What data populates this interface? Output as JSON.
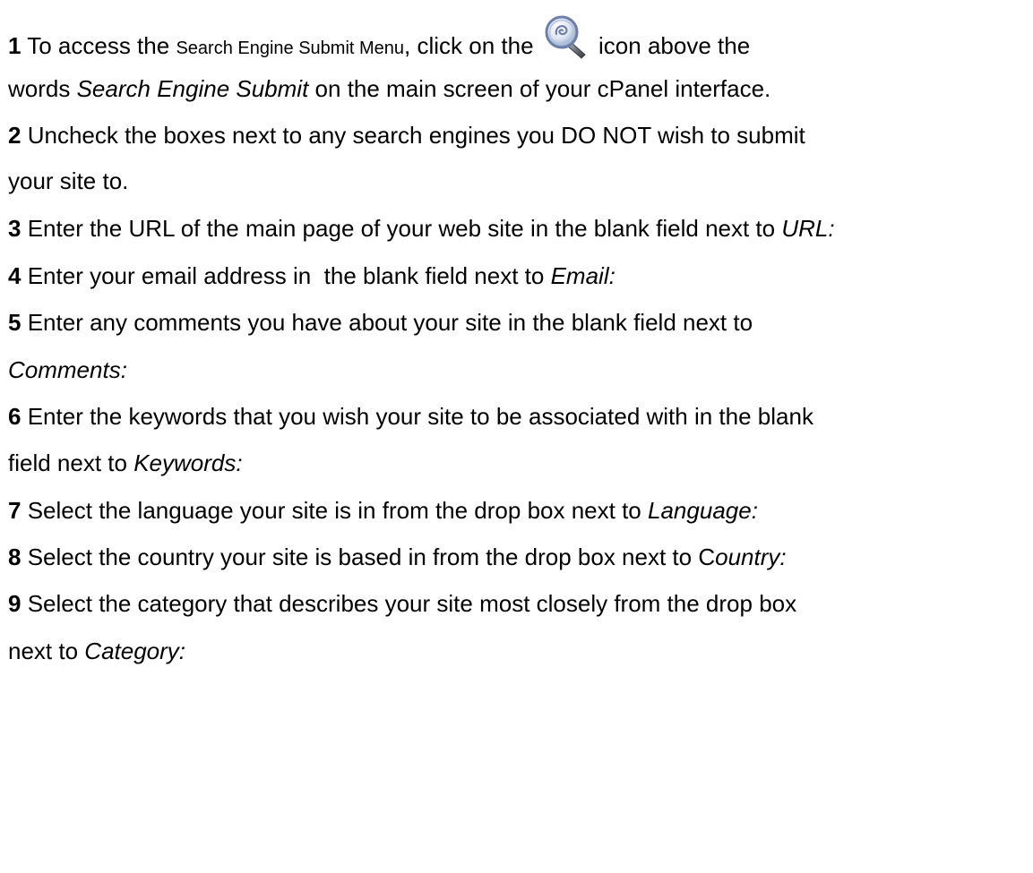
{
  "steps": [
    {
      "number": "1",
      "l1_a": "To access the",
      "l1_b": "Search Engine Submit Menu",
      "l1_c": ", click on the",
      "icon": "search-magnifier-icon",
      "l1_d": "icon above the",
      "l2_a": "words",
      "l2_b": "Search Engine Submit",
      "l2_c": "on the main screen of your cPanel interface."
    },
    {
      "number": "2",
      "l1": "Uncheck the boxes next to any search engines you DO NOT wish to submit",
      "l2": "your site to."
    },
    {
      "number": "3",
      "l1_a": "Enter the URL of the main page of your web site in the blank field next to",
      "l1_b": "URL:"
    },
    {
      "number": "4",
      "l1_a": "Enter your email address in  the blank field next to",
      "l1_b": "Email:"
    },
    {
      "number": "5",
      "l1": "Enter any comments you have about your site in the blank field next to",
      "l2": "Comments:"
    },
    {
      "number": "6",
      "l1": "Enter the keywords that you wish your site to be associated with in the blank",
      "l2_a": "field next to",
      "l2_b": "Keywords:"
    },
    {
      "number": "7",
      "l1_a": "Select the language your site is in from the drop box next to",
      "l1_b": "Language:"
    },
    {
      "number": "8",
      "l1_a": "Select the country your site is based in from the drop box next to C",
      "l1_b": "ountry:"
    },
    {
      "number": "9",
      "l1": "Select the category that describes your site most closely from the drop box",
      "l2_a": "next to",
      "l2_b": "Category:"
    }
  ]
}
